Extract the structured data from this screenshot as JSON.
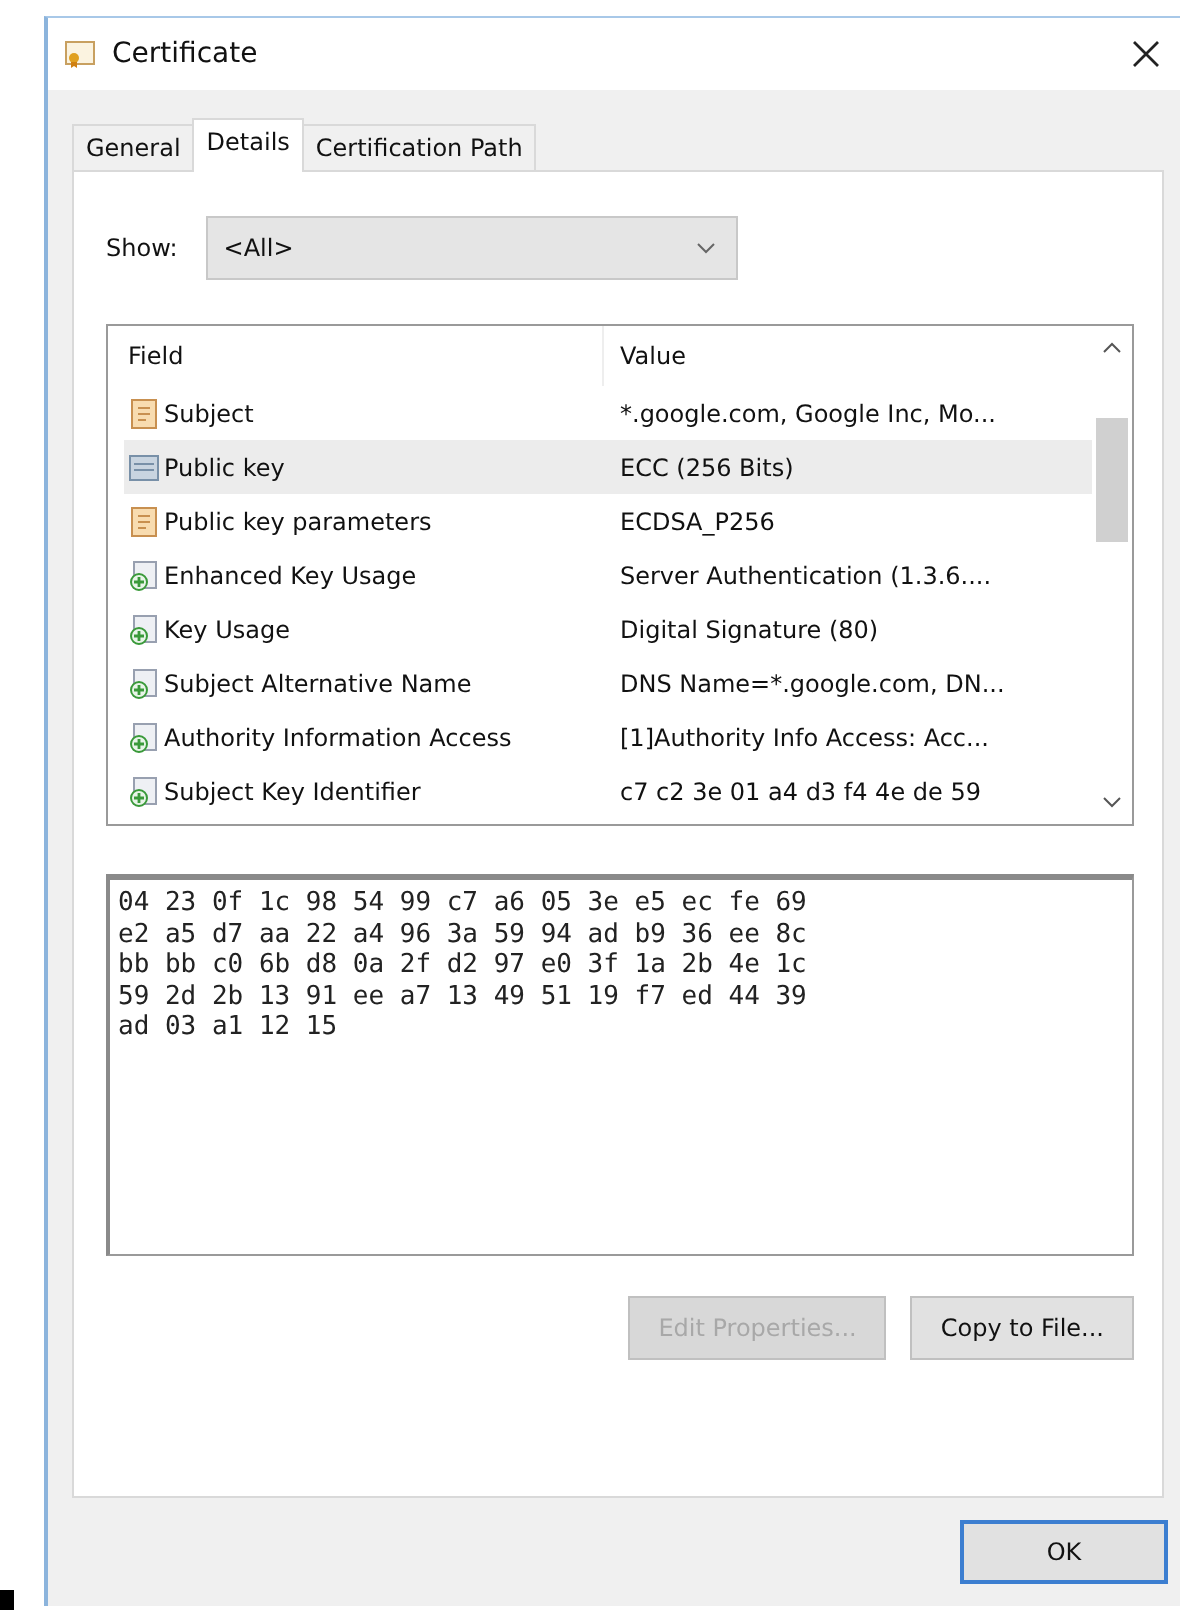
{
  "window": {
    "title": "Certificate"
  },
  "tabs": [
    {
      "label": "General",
      "selected": false
    },
    {
      "label": "Details",
      "selected": true
    },
    {
      "label": "Certification Path",
      "selected": false
    }
  ],
  "show": {
    "label": "Show:",
    "value": "<All>"
  },
  "table": {
    "columns": [
      "Field",
      "Value"
    ],
    "rows": [
      {
        "kind": "document",
        "field": "Subject",
        "value": "*.google.com, Google Inc, Mo...",
        "selected": false
      },
      {
        "kind": "key",
        "field": "Public key",
        "value": "ECC (256 Bits)",
        "selected": true
      },
      {
        "kind": "document",
        "field": "Public key parameters",
        "value": "ECDSA_P256",
        "selected": false
      },
      {
        "kind": "extension",
        "field": "Enhanced Key Usage",
        "value": "Server Authentication (1.3.6....",
        "selected": false
      },
      {
        "kind": "extension",
        "field": "Key Usage",
        "value": "Digital Signature (80)",
        "selected": false
      },
      {
        "kind": "extension",
        "field": "Subject Alternative Name",
        "value": "DNS Name=*.google.com, DN...",
        "selected": false
      },
      {
        "kind": "extension",
        "field": "Authority Information Access",
        "value": "[1]Authority Info Access: Acc...",
        "selected": false
      },
      {
        "kind": "extension",
        "field": "Subject Key Identifier",
        "value": "c7 c2 3e 01 a4 d3 f4 4e de 59",
        "selected": false
      }
    ]
  },
  "detail_text": [
    "04 23 0f 1c 98 54 99 c7 a6 05 3e e5 ec fe 69",
    "e2 a5 d7 aa 22 a4 96 3a 59 94 ad b9 36 ee 8c",
    "bb bb c0 6b d8 0a 2f d2 97 e0 3f 1a 2b 4e 1c",
    "59 2d 2b 13 91 ee a7 13 49 51 19 f7 ed 44 39",
    "ad 03 a1 12 15"
  ],
  "buttons": [
    {
      "label": "Edit Properties...",
      "disabled": true
    },
    {
      "label": "Copy to File...",
      "disabled": false
    }
  ],
  "footer_buttons": [
    {
      "label": "OK",
      "default": true
    }
  ]
}
